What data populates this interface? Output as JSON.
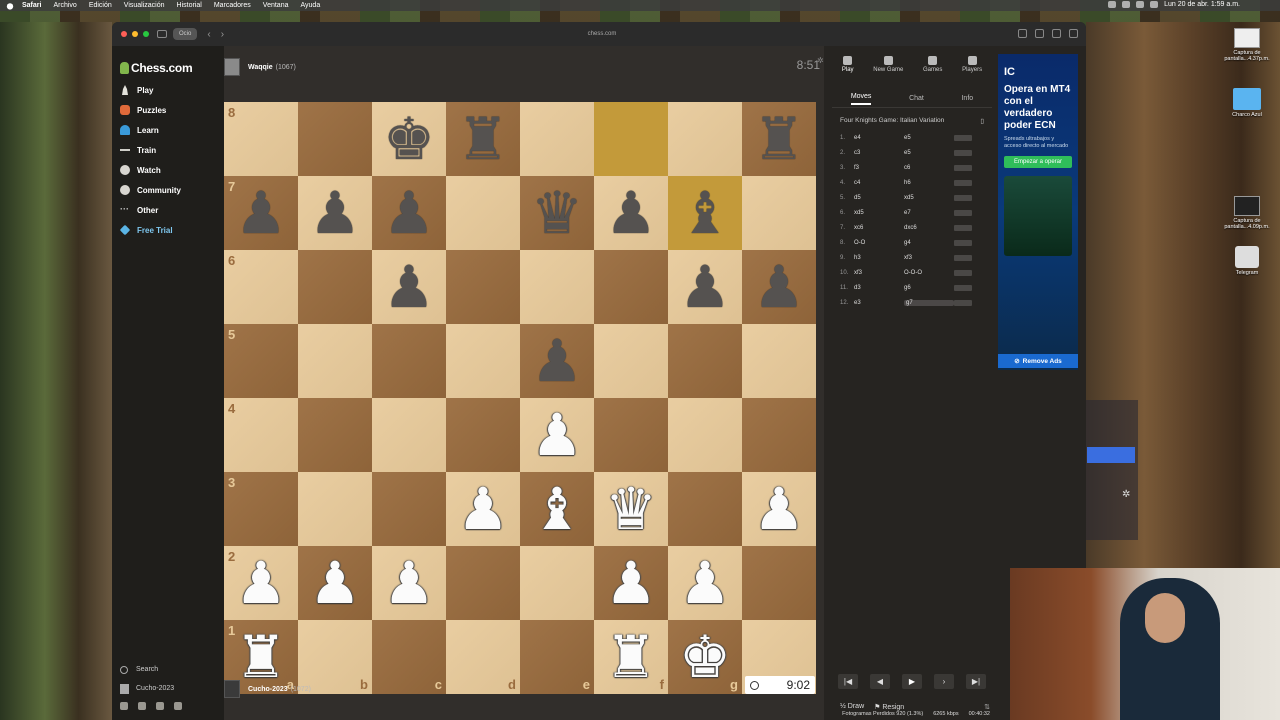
{
  "menubar": {
    "app": "Safari",
    "items": [
      "Archivo",
      "Edición",
      "Visualización",
      "Historial",
      "Marcadores",
      "Ventana",
      "Ayuda"
    ],
    "datetime": "Lun 20 de abr.  1:59 a.m."
  },
  "browser": {
    "tab_group": "Ocio",
    "url": "chess.com"
  },
  "sidebar": {
    "logo": "Chess.com",
    "items": [
      {
        "label": "Play",
        "icon": "pawn-icon"
      },
      {
        "label": "Puzzles",
        "icon": "puzzle-icon"
      },
      {
        "label": "Learn",
        "icon": "learn-icon"
      },
      {
        "label": "Train",
        "icon": "train-icon"
      },
      {
        "label": "Watch",
        "icon": "watch-icon"
      },
      {
        "label": "Community",
        "icon": "community-icon"
      },
      {
        "label": "Other",
        "icon": "more-icon"
      },
      {
        "label": "Free Trial",
        "icon": "diamond-icon"
      }
    ],
    "search": "Search",
    "user": "Cucho-2023"
  },
  "top_player": {
    "name": "Waqqie",
    "rating": "(1067)",
    "clock": "8:51"
  },
  "bottom_player": {
    "name": "Cucho-2023",
    "rating": "(1072)",
    "clock": "9:02"
  },
  "board": {
    "ranks": [
      "8",
      "7",
      "6",
      "5",
      "4",
      "3",
      "2",
      "1"
    ],
    "files": [
      "a",
      "b",
      "c",
      "d",
      "e",
      "f",
      "g",
      "h"
    ],
    "position": [
      [
        "",
        "",
        "bK",
        "bR",
        "",
        "",
        "",
        "bR"
      ],
      [
        "bP",
        "bP",
        "bP",
        "",
        "bQ",
        "bP",
        "bB",
        ""
      ],
      [
        "",
        "",
        "bP",
        "",
        "",
        "",
        "bP",
        "bP"
      ],
      [
        "",
        "",
        "",
        "",
        "bP",
        "",
        "",
        ""
      ],
      [
        "",
        "",
        "",
        "",
        "wP",
        "",
        "",
        ""
      ],
      [
        "",
        "",
        "",
        "wP",
        "wB",
        "wQ",
        "",
        "wP"
      ],
      [
        "wP",
        "wP",
        "wP",
        "",
        "",
        "wP",
        "wP",
        ""
      ],
      [
        "wR",
        "",
        "",
        "",
        "",
        "wR",
        "wK",
        ""
      ]
    ],
    "highlight": [
      [
        0,
        5
      ],
      [
        1,
        6
      ]
    ]
  },
  "panel": {
    "tabs": [
      "Play",
      "New Game",
      "Games",
      "Players"
    ],
    "subtabs": [
      "Moves",
      "Chat",
      "Info"
    ],
    "opening": "Four Knights Game: Italian Variation",
    "moves": [
      {
        "n": "1.",
        "w": "e4",
        "b": "e5"
      },
      {
        "n": "2.",
        "w": "c3",
        "b": "e5"
      },
      {
        "n": "3.",
        "w": "f3",
        "b": "c6"
      },
      {
        "n": "4.",
        "w": "c4",
        "b": "h6"
      },
      {
        "n": "5.",
        "w": "d5",
        "b": "xd5"
      },
      {
        "n": "6.",
        "w": "xd5",
        "b": "e7"
      },
      {
        "n": "7.",
        "w": "xc6",
        "b": "dxc6"
      },
      {
        "n": "8.",
        "w": "O-O",
        "b": "g4"
      },
      {
        "n": "9.",
        "w": "h3",
        "b": "xf3"
      },
      {
        "n": "10.",
        "w": "xf3",
        "b": "O-O-O"
      },
      {
        "n": "11.",
        "w": "d3",
        "b": "g6"
      },
      {
        "n": "12.",
        "w": "e3",
        "b": "g7"
      }
    ],
    "draw": "Draw",
    "resign": "Resign"
  },
  "ad": {
    "logo": "IC",
    "title": "Opera en MT4 con el verdadero poder ECN",
    "subtitle": "Spreads ultrabajos y acceso directo al mercado",
    "button": "Empezar a operar",
    "remove": "Remove Ads"
  },
  "desktop": {
    "items": [
      "Captura de pantalla...4.37p.m.",
      "Charco Azul",
      "Captura de pantalla...4.09p.m.",
      "Telegram"
    ]
  },
  "status": {
    "frames": "Fotogramas Perdidos 920 (1.3%)",
    "kbps": "6265 kbps",
    "time": "00:40:32"
  }
}
